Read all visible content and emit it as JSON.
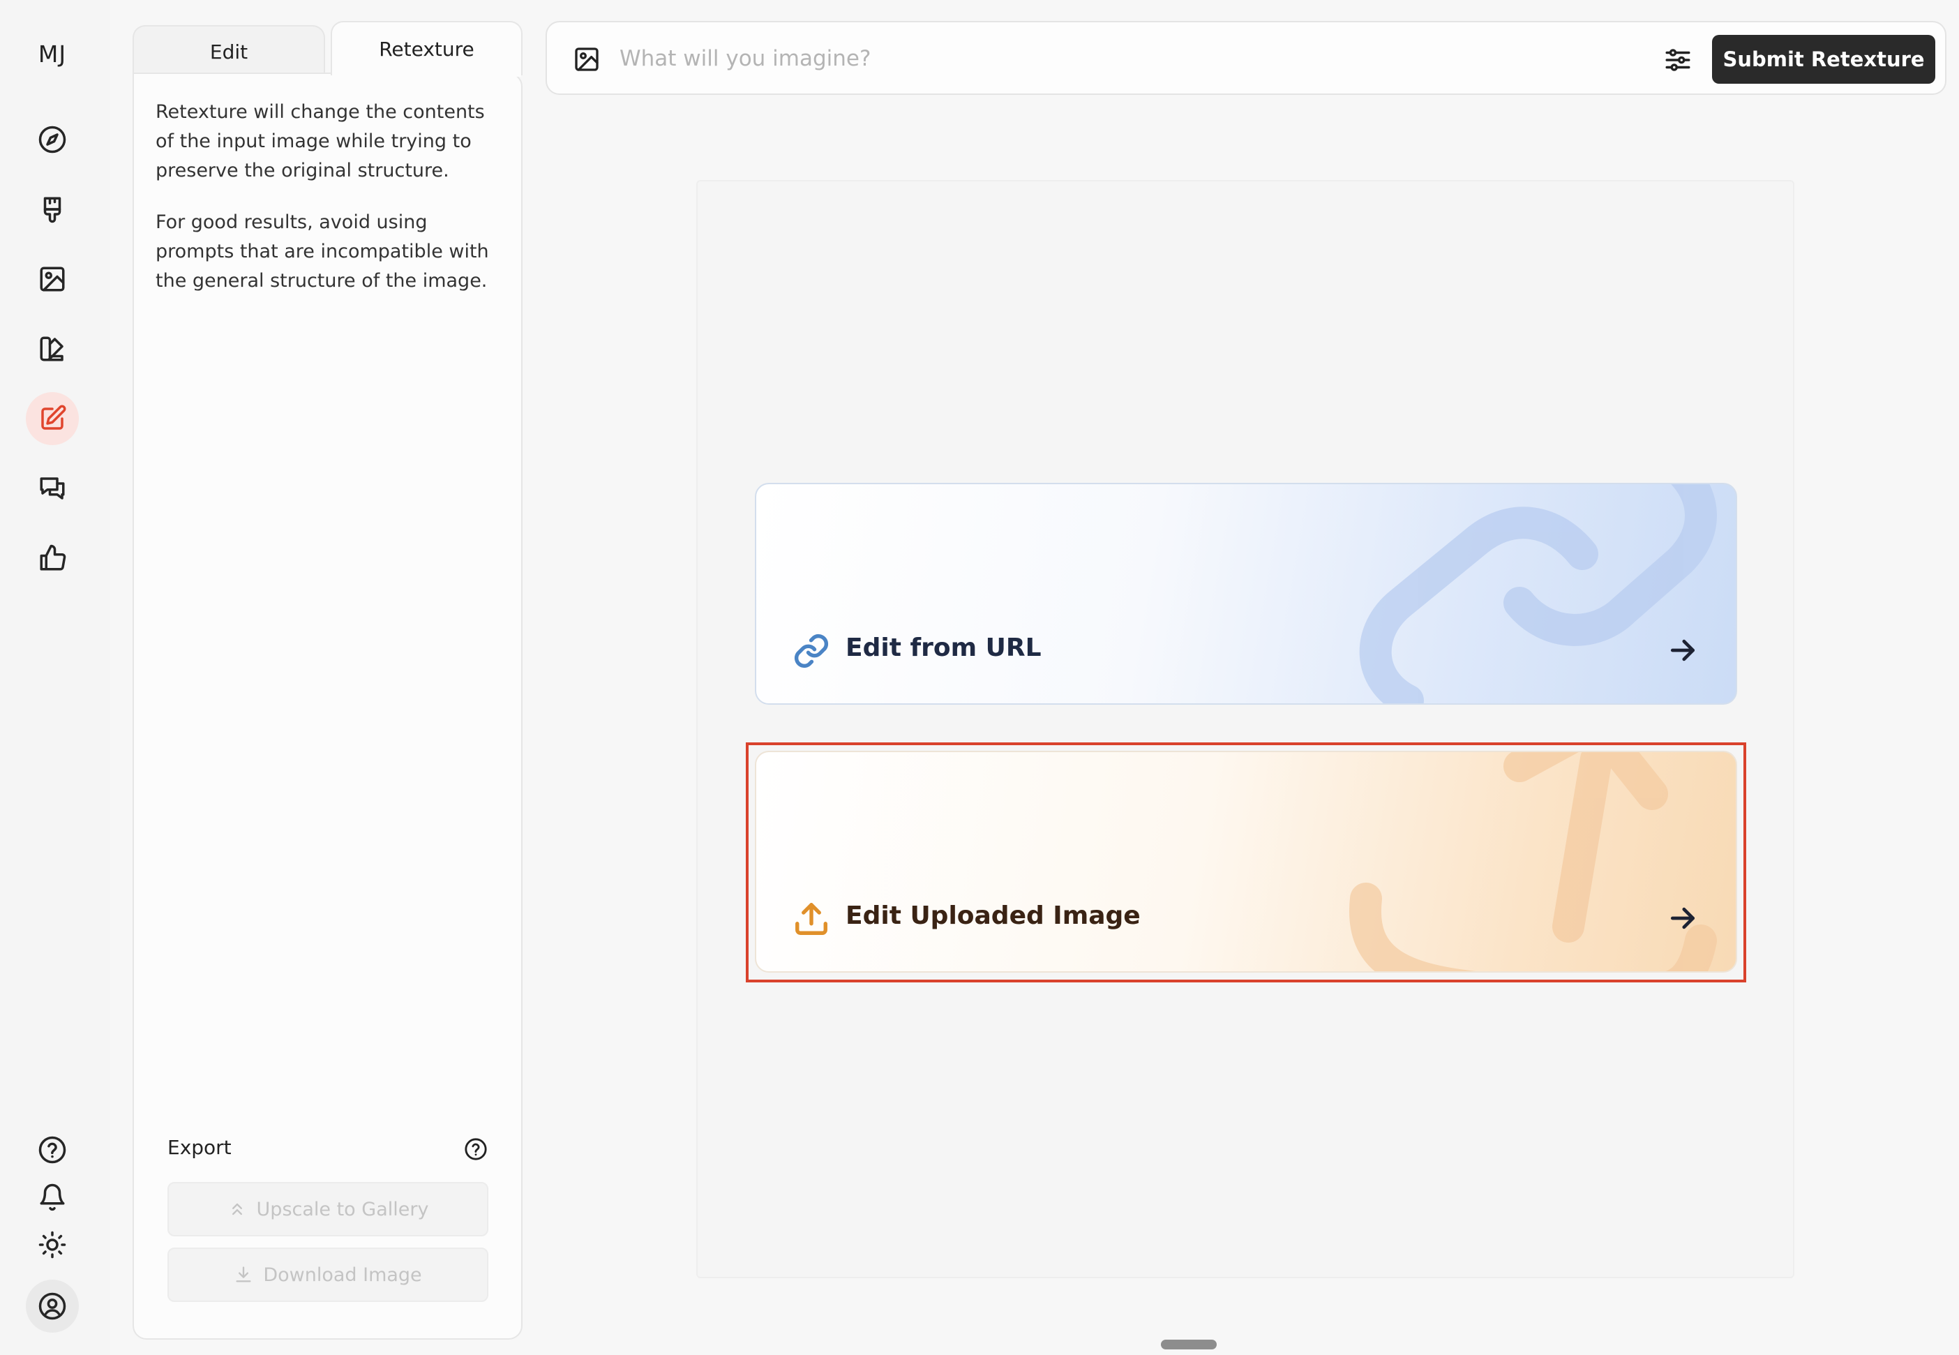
{
  "app": {
    "logo": "MJ"
  },
  "rail": {
    "items": [
      {
        "name": "explore",
        "icon": "compass-icon"
      },
      {
        "name": "create",
        "icon": "paintbrush-icon"
      },
      {
        "name": "organize",
        "icon": "image-icon"
      },
      {
        "name": "personalize",
        "icon": "palette-icon"
      },
      {
        "name": "edit",
        "icon": "edit-icon",
        "active": true
      },
      {
        "name": "chat",
        "icon": "chat-bubbles-icon"
      },
      {
        "name": "rate",
        "icon": "thumbs-up-icon"
      }
    ],
    "bottom": [
      {
        "name": "help",
        "icon": "help-icon"
      },
      {
        "name": "notifications",
        "icon": "bell-icon"
      },
      {
        "name": "theme",
        "icon": "sun-icon"
      },
      {
        "name": "account",
        "icon": "user-circle-icon"
      }
    ],
    "active_color": "#e0452d"
  },
  "panel": {
    "tabs": [
      {
        "label": "Edit",
        "active": false
      },
      {
        "label": "Retexture",
        "active": true
      }
    ],
    "description_1": "Retexture will change the contents of the input image while trying to preserve the original structure.",
    "description_2": "For good results, avoid using prompts that are incompatible with the general structure of the image.",
    "export": {
      "label": "Export",
      "upscale_label": "Upscale to Gallery",
      "download_label": "Download Image"
    }
  },
  "prompt": {
    "placeholder": "What will you imagine?",
    "value": "",
    "submit_label": "Submit Retexture"
  },
  "cards": {
    "url": {
      "label": "Edit from URL",
      "icon": "link-icon",
      "accent": "#4a84c5"
    },
    "upload": {
      "label": "Edit Uploaded Image",
      "icon": "upload-icon",
      "accent": "#e0902a"
    }
  },
  "colors": {
    "submit_bg": "#2a2a2a",
    "highlight": "#d9422c"
  }
}
